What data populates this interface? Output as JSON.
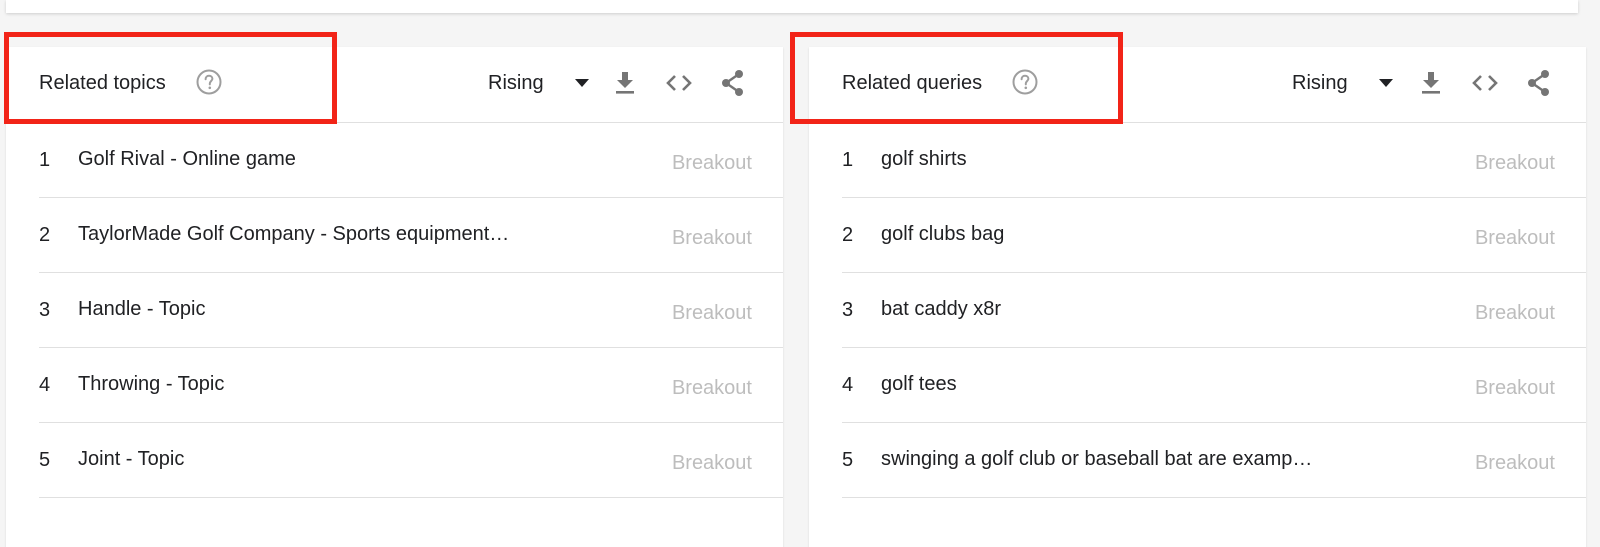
{
  "colors": {
    "highlight": "#f22418",
    "text": "#202124",
    "muted_value": "#bdbdbd",
    "icon": "#757575",
    "divider": "#e0e0e0"
  },
  "related_topics": {
    "title": "Related topics",
    "filter_selected": "Rising",
    "icons": [
      "help-icon",
      "dropdown-caret-icon",
      "download-icon",
      "embed-code-icon",
      "share-icon"
    ],
    "rows": [
      {
        "index": "1",
        "label": "Golf Rival - Online game",
        "value": "Breakout"
      },
      {
        "index": "2",
        "label": "TaylorMade Golf Company - Sports equipment…",
        "value": "Breakout"
      },
      {
        "index": "3",
        "label": "Handle - Topic",
        "value": "Breakout"
      },
      {
        "index": "4",
        "label": "Throwing - Topic",
        "value": "Breakout"
      },
      {
        "index": "5",
        "label": "Joint - Topic",
        "value": "Breakout"
      }
    ]
  },
  "related_queries": {
    "title": "Related queries",
    "filter_selected": "Rising",
    "icons": [
      "help-icon",
      "dropdown-caret-icon",
      "download-icon",
      "embed-code-icon",
      "share-icon"
    ],
    "rows": [
      {
        "index": "1",
        "label": "golf shirts",
        "value": "Breakout"
      },
      {
        "index": "2",
        "label": "golf clubs bag",
        "value": "Breakout"
      },
      {
        "index": "3",
        "label": "bat caddy x8r",
        "value": "Breakout"
      },
      {
        "index": "4",
        "label": "golf tees",
        "value": "Breakout"
      },
      {
        "index": "5",
        "label": "swinging a golf club or baseball bat are examp…",
        "value": "Breakout"
      }
    ]
  }
}
